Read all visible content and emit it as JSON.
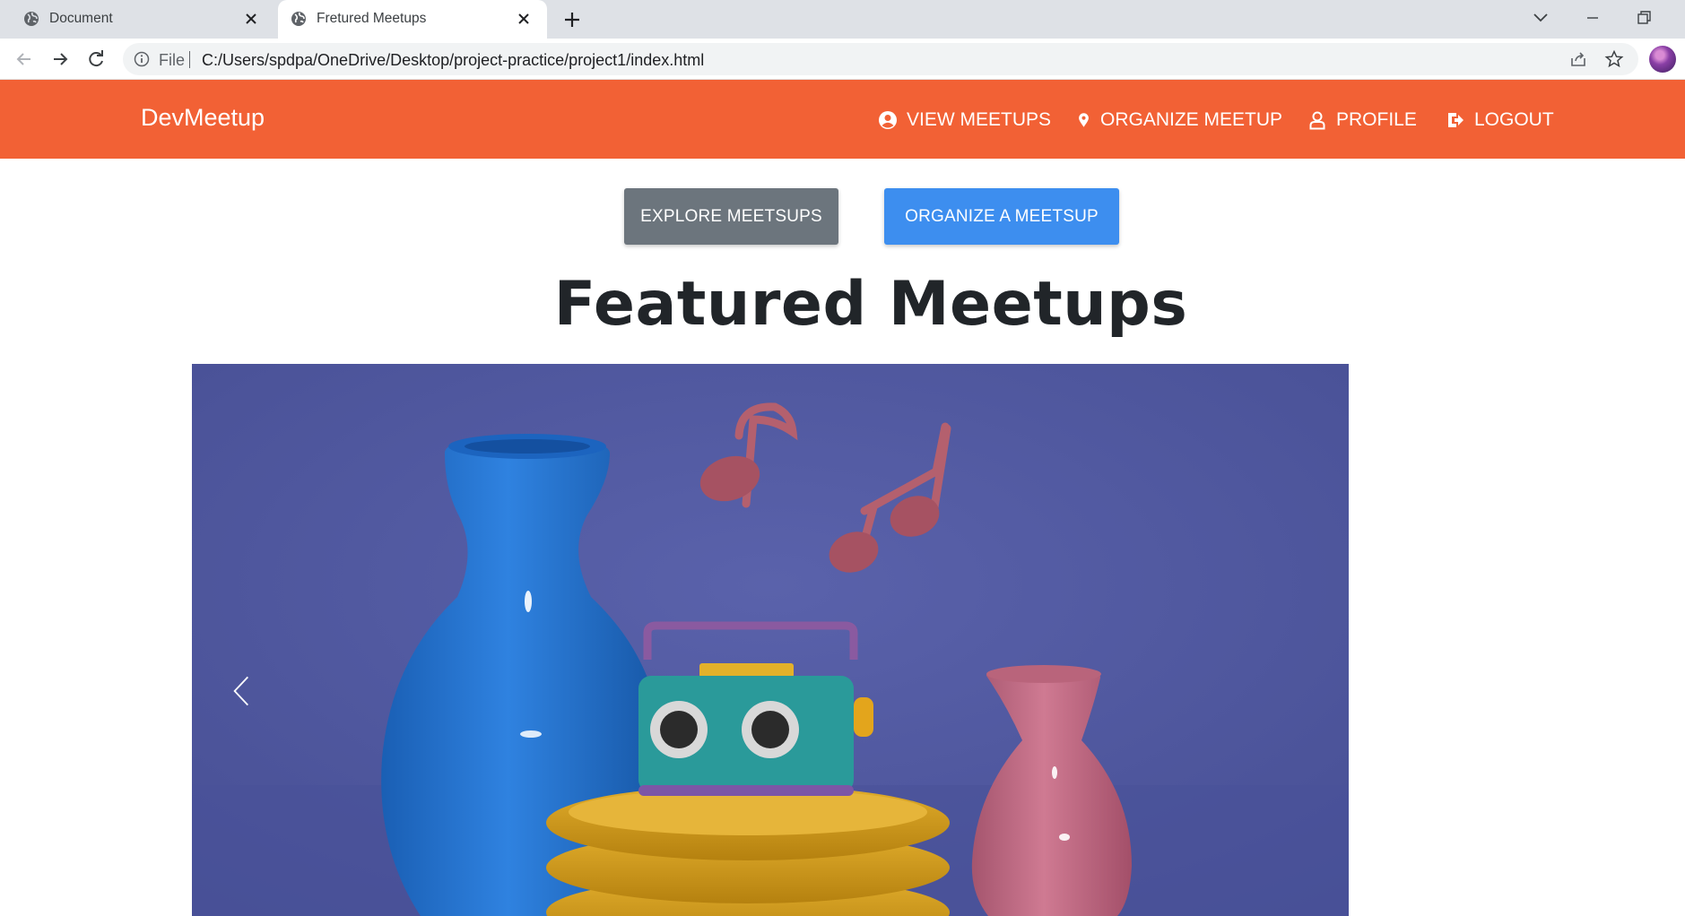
{
  "browser": {
    "tabs": [
      {
        "title": "Document",
        "active": false
      },
      {
        "title": "Fretured Meetups",
        "active": true
      }
    ],
    "address": {
      "scheme_label": "File",
      "url": "C:/Users/spdpa/OneDrive/Desktop/project-practice/project1/index.html"
    }
  },
  "navbar": {
    "brand": "DevMeetup",
    "items": [
      {
        "label": "VIEW MEETUPS",
        "icon": "account-circle-icon"
      },
      {
        "label": "ORGANIZE MEETUP",
        "icon": "map-pin-icon"
      },
      {
        "label": "PROFILE",
        "icon": "person-icon"
      },
      {
        "label": "LOGOUT",
        "icon": "logout-icon"
      }
    ]
  },
  "hero": {
    "explore_label": "EXPLORE MEETSUPS",
    "organize_label": "ORGANIZE A MEETSUP"
  },
  "featured": {
    "title": "Featured Meetups"
  },
  "colors": {
    "navbar": "#f26135",
    "explore_button": "#6c757d",
    "organize_button": "#3d8eef",
    "carousel_background": "#5058a0"
  }
}
